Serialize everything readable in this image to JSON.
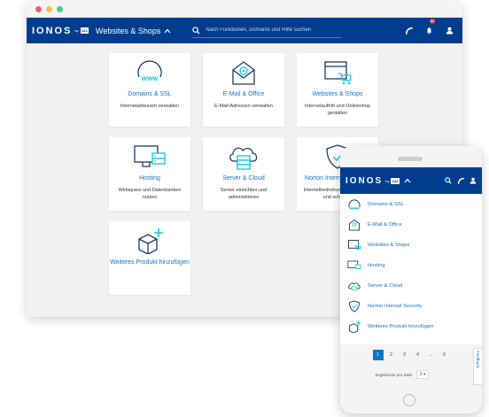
{
  "window": {
    "dots": [
      "#f05a78",
      "#f5c04a",
      "#3fcf8e"
    ]
  },
  "appbar": {
    "brand": "IONOS",
    "brand_by": "by",
    "brand_badge": "1&1",
    "menu_title": "Websites & Shops",
    "search_placeholder": "Nach Funktionen, Domains und Hilfe suchen",
    "notification_count": "50"
  },
  "cards": [
    {
      "title": "Domains & SSL",
      "desc": "Internetadressen verwalten",
      "icon": "globe-www-icon"
    },
    {
      "title": "E-Mail & Office",
      "desc": "E-Mail-Adressen verwalten",
      "icon": "envelope-at-icon"
    },
    {
      "title": "Websites & Shops",
      "desc": "Internetauftritt und Onlineshop gestalten",
      "icon": "browser-cart-icon"
    },
    {
      "title": "Hosting",
      "desc": "Webspace und Datenbanken nutzen",
      "icon": "monitor-server-icon"
    },
    {
      "title": "Server & Cloud",
      "desc": "Server einrichten und administrieren",
      "icon": "cloud-server-icon"
    },
    {
      "title": "Norton Internet Security",
      "desc": "Internetbedrohungen abwehren und schützen",
      "icon": "shield-check-icon"
    },
    {
      "title": "Weiteres Produkt hinzufügen",
      "desc": "",
      "icon": "box-plus-icon"
    }
  ],
  "mobile": {
    "brand": "IONOS",
    "brand_by": "by",
    "brand_badge": "1&1",
    "items": [
      {
        "label": "Domains & SSL",
        "icon": "globe-www-icon"
      },
      {
        "label": "E-Mail & Office",
        "icon": "envelope-at-icon"
      },
      {
        "label": "Websites & Shops",
        "icon": "browser-cart-icon"
      },
      {
        "label": "Hosting",
        "icon": "monitor-server-icon"
      },
      {
        "label": "Server & Cloud",
        "icon": "cloud-server-icon"
      },
      {
        "label": "Norton Internet Security",
        "icon": "shield-check-icon"
      },
      {
        "label": "Weiteres Produkt hinzufügen",
        "icon": "box-plus-icon"
      }
    ],
    "pages": [
      "1",
      "2",
      "3",
      "4",
      "...",
      "6"
    ],
    "per_page_label": "Ergebnisse pro Seite",
    "per_page_value": "3",
    "feedback_label": "Feedback"
  },
  "colors": {
    "brand_blue": "#003d8f",
    "link_blue": "#1474c4",
    "icon_blue": "#11c7e6"
  }
}
